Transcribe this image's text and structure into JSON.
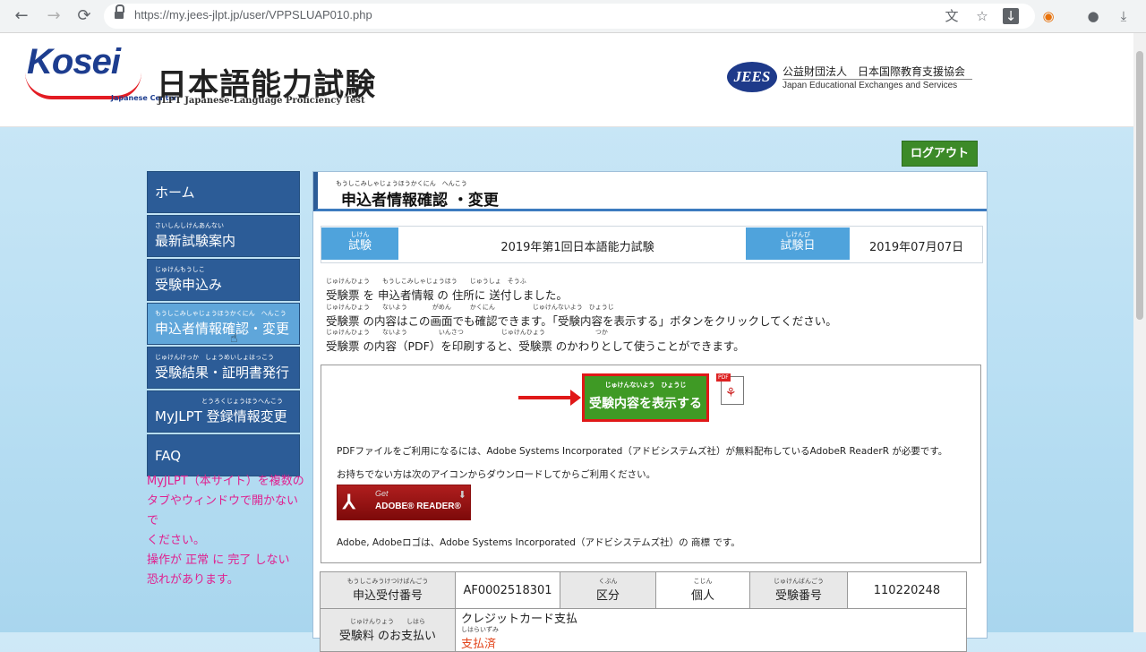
{
  "browser": {
    "url": "https://my.jees-jlpt.jp/user/VPPSLUAP010.php",
    "back_glyph": "←",
    "forward_glyph": "→",
    "reload_glyph": "⟳",
    "icons": [
      "translate-icon",
      "star-icon",
      "download-icon",
      "extension-icon",
      "account-icon",
      "menu-icon"
    ]
  },
  "header": {
    "kosei_text": "Kosei",
    "kosei_sub": "Japanese Center",
    "jlpt_title": "日本語能力試験",
    "jlpt_sub": "JLPT Japanese-Language Proficiency Test",
    "jees_logo": "JEES",
    "jees_jp": "公益財団法人　日本国際教育支援協会",
    "jees_en": "Japan Educational Exchanges and Services"
  },
  "logout_label": "ログアウト",
  "sidebar": {
    "items": [
      {
        "ruby": "",
        "label": "ホーム"
      },
      {
        "ruby": "さいしんしけんあんない",
        "label": "最新試験案内"
      },
      {
        "ruby": "じゅけんもうしこ",
        "label": "受験申込み"
      },
      {
        "ruby": "もうしこみしゃじょうほうかくにん　へんこう",
        "label": "申込者情報確認・変更"
      },
      {
        "ruby": "じゅけんけっか　しょうめいしょはっこう",
        "label": "受験結果・証明書発行"
      },
      {
        "ruby": "とうろくじょうほうへんこう",
        "label": "MyJLPT 登録情報変更"
      },
      {
        "ruby": "",
        "label": "FAQ"
      }
    ],
    "note_lines": [
      "MyJLPT（本サイト）を複数の",
      "タブやウィンドウで開かないで",
      "ください。",
      "操作が 正常 に 完了 しない",
      "恐れがあります。"
    ]
  },
  "main": {
    "title_ruby": "もうしこみしゃじょうほうかくにん　へんこう",
    "title": "申込者情報確認 ・変更",
    "exam_label_ruby": "しけん",
    "exam_label": "試験",
    "exam_name": "2019年第1回日本語能力試験",
    "date_label_ruby": "しけんび",
    "date_label": "試験日",
    "exam_date": "2019年07月07日",
    "info_lines": [
      {
        "ruby": "じゅけんひょう　　もうしこみしゃじょうほう　　じゅうしょ　そうふ",
        "text": "受験票 を 申込者情報 の 住所に 送付しました。"
      },
      {
        "ruby": "じゅけんひょう　　ないよう　　　　がめん　　　かくにん　　　　　　じゅけんないよう　ひょうじ",
        "text": "受験票 の内容はこの画面でも確認できます。「受験内容を表示する」ボタンをクリックしてください。"
      },
      {
        "ruby": "じゅけんひょう　　ないよう　　　　　いんさつ　　　　　　じゅけんひょう　　　　　　　　つか",
        "text": "受験票 の内容（PDF）を印刷すると、受験票 のかわりとして使うことができます。"
      }
    ],
    "show_btn_ruby": "じゅけんないよう　ひょうじ",
    "show_btn": "受験内容を表示する",
    "pdf_tag": "PDF",
    "pdf_text1": "PDFファイルをご利用になるには、Adobe Systems Incorporated（アドビシステムズ社）が無料配布しているAdobeR ReaderR が必要です。",
    "pdf_text2": "お持ちでない方は次のアイコンからダウンロードしてからご利用ください。",
    "adobe_get": "Get",
    "adobe_name": "ADOBE® READER®",
    "pdf_text3": "Adobe, Adobeロゴは、Adobe Systems Incorporated（アドビシステムズ社）の 商標 です。"
  },
  "table": {
    "row1": [
      {
        "ruby": "もうしこみうけつけばんごう",
        "text": "申込受付番号",
        "head": true
      },
      {
        "ruby": "",
        "text": "AF0002518301",
        "head": false
      },
      {
        "ruby": "くぶん",
        "text": "区分",
        "head": true
      },
      {
        "ruby": "こじん",
        "text": "個人",
        "head": false
      },
      {
        "ruby": "じゅけんばんごう",
        "text": "受験番号",
        "head": true
      },
      {
        "ruby": "",
        "text": "110220248",
        "head": false
      }
    ],
    "row2_label_ruby": "じゅけんりょう　　しはら",
    "row2_label": "受験料 のお支払い",
    "row2_value": "クレジットカード支払",
    "row2_status_ruby": "しはらいずみ",
    "row2_status": "支払済"
  }
}
